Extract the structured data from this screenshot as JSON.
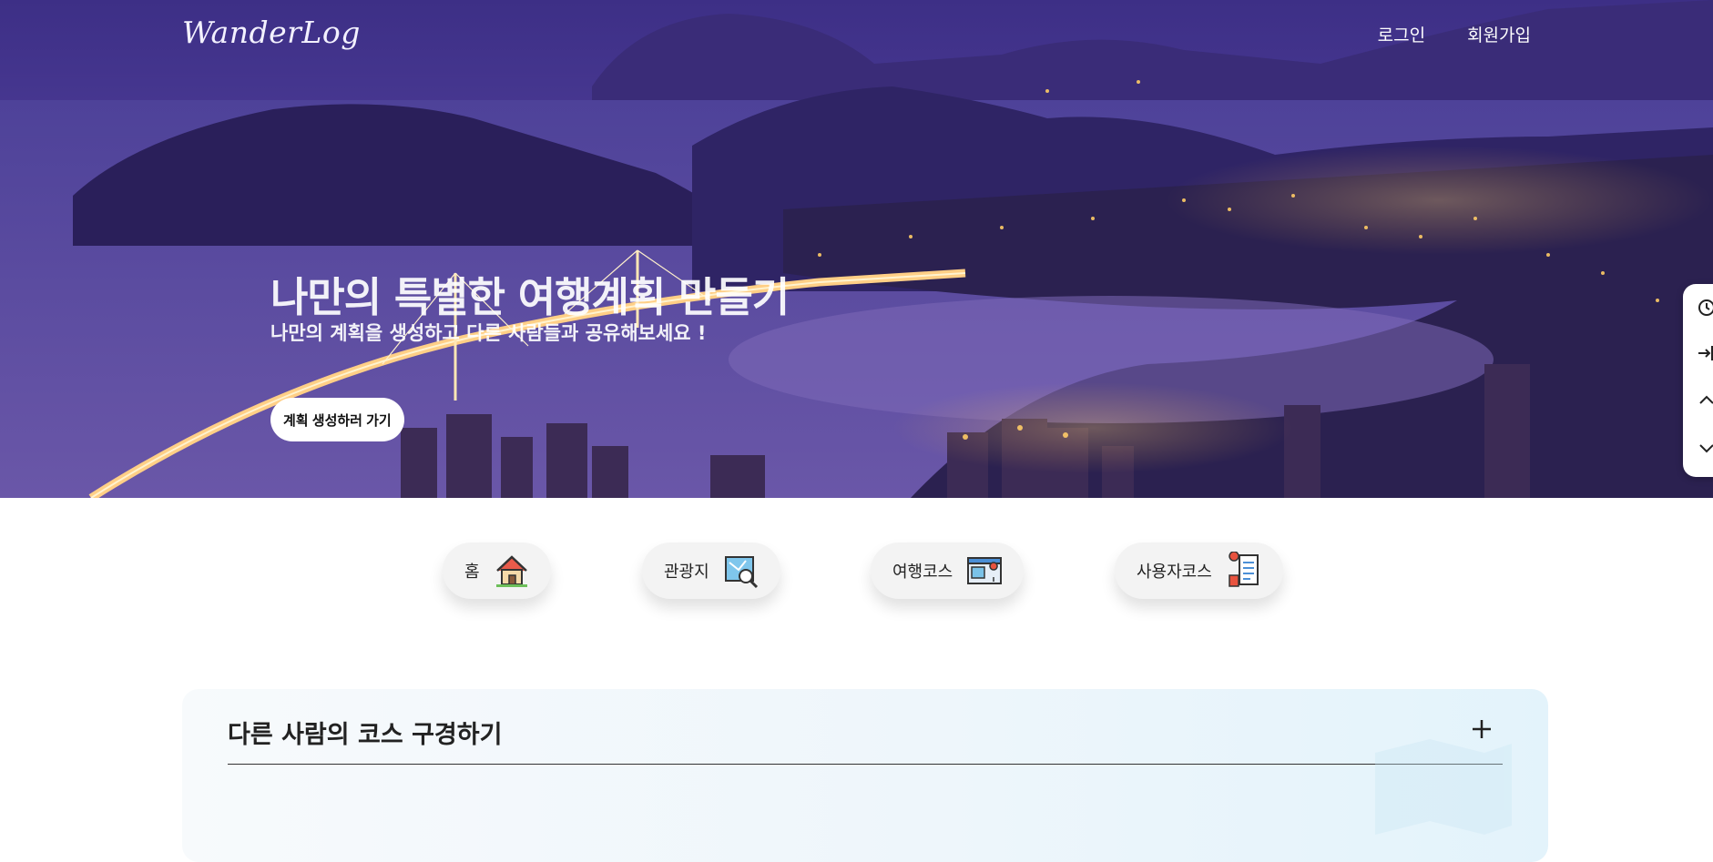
{
  "header": {
    "logo": "WanderLog",
    "nav": [
      {
        "label": "로그인"
      },
      {
        "label": "회원가입"
      }
    ]
  },
  "hero": {
    "title": "나만의 특별한 여행계획 만들기",
    "subtitle": "나만의 계획을 생성하고 다른 사람들과 공유해보세요 !",
    "cta_label": "계획 생성하러 가기"
  },
  "side_tools": [
    {
      "icon": "history-icon"
    },
    {
      "icon": "login-arrow-icon"
    },
    {
      "icon": "scroll-up-icon"
    },
    {
      "icon": "scroll-down-icon"
    }
  ],
  "categories": [
    {
      "label": "홈",
      "icon": "house-icon"
    },
    {
      "label": "관광지",
      "icon": "map-search-icon"
    },
    {
      "label": "여행코스",
      "icon": "route-map-icon"
    },
    {
      "label": "사용자코스",
      "icon": "user-route-icon"
    }
  ],
  "course_panel": {
    "title": "다른 사람의 코스 구경하기",
    "toggle_icon": "plus-icon"
  },
  "colors": {
    "hero_sky": "#3d2f86",
    "city_lights": "#ffb84a",
    "panel_bg": "#eef6fb",
    "pill_bg": "#f3f3f3"
  }
}
